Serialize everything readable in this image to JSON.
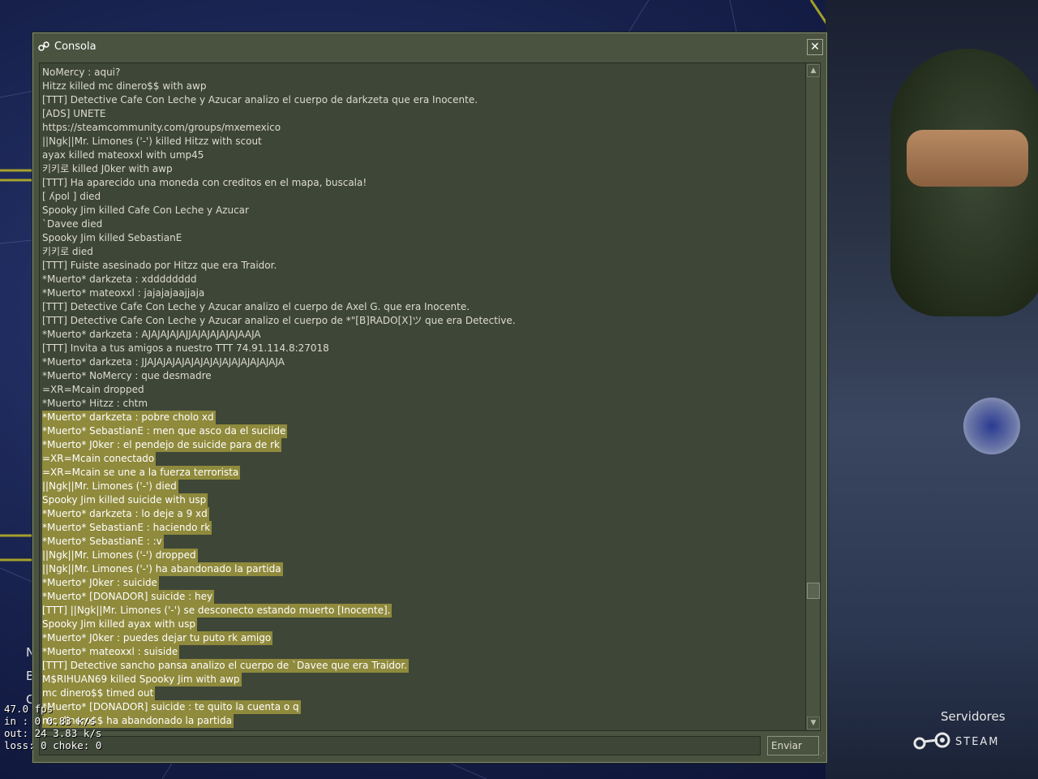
{
  "window": {
    "title": "Consola",
    "send_label": "Enviar",
    "input_value": ""
  },
  "log": [
    {
      "text": " NoMercy : aqui?",
      "hl": false
    },
    {
      "text": "Hitzz killed mc dinero$$ with awp",
      "hl": false
    },
    {
      "text": "[TTT] Detective Cafe Con Leche y Azucar analizo el cuerpo de darkzeta que era Inocente.",
      "hl": false
    },
    {
      "text": "[ADS] UNETE",
      "hl": false
    },
    {
      "text": "https://steamcommunity.com/groups/mxemexico",
      "hl": false
    },
    {
      "text": "||Ngk||Mr. Limones ('-') killed Hitzz with scout",
      "hl": false
    },
    {
      "text": "ayax killed mateoxxl with ump45",
      "hl": false
    },
    {
      "text": "키키로 killed J0ker with awp",
      "hl": false
    },
    {
      "text": "[TTT] Ha aparecido una moneda con creditos en el mapa, buscala!",
      "hl": false
    },
    {
      "text": "[ ʎpol ] died",
      "hl": false
    },
    {
      "text": "Spooky Jim killed Cafe Con Leche y Azucar",
      "hl": false
    },
    {
      "text": "`Davee died",
      "hl": false
    },
    {
      "text": "Spooky Jim killed SebastianE",
      "hl": false
    },
    {
      "text": "키키로 died",
      "hl": false
    },
    {
      "text": "[TTT] Fuiste asesinado por Hitzz que era Traidor.",
      "hl": false
    },
    {
      "text": "*Muerto*  darkzeta : xdddddddd",
      "hl": false
    },
    {
      "text": "*Muerto*  mateoxxl : jajajajaajjaja",
      "hl": false
    },
    {
      "text": "[TTT] Detective Cafe Con Leche y Azucar analizo el cuerpo de Axel G. que era Inocente.",
      "hl": false
    },
    {
      "text": "[TTT] Detective Cafe Con Leche y Azucar analizo el cuerpo de *\"[B]RADO[X]ツ que era Detective.",
      "hl": false
    },
    {
      "text": "*Muerto*  darkzeta : AJAJAJAJAJJAJAJAJAJAJAAJA",
      "hl": false
    },
    {
      "text": "[TTT] Invita a tus amigos a nuestro TTT 74.91.114.8:27018",
      "hl": false
    },
    {
      "text": "*Muerto*  darkzeta : JJAJAJAJAJAJAJAJAJAJAJAJAJAJAJA",
      "hl": false
    },
    {
      "text": "*Muerto*  NoMercy : que desmadre",
      "hl": false
    },
    {
      "text": "=XR=Mcain dropped",
      "hl": false
    },
    {
      "text": "*Muerto*  Hitzz : chtm",
      "hl": false
    },
    {
      "text": "*Muerto*  darkzeta : pobre cholo xd",
      "hl": true
    },
    {
      "text": "*Muerto*  SebastianE : men que asco da el suciide",
      "hl": true
    },
    {
      "text": "*Muerto*  J0ker : el pendejo de suicide para de rk",
      "hl": true
    },
    {
      "text": "=XR=Mcain conectado",
      "hl": true
    },
    {
      "text": "=XR=Mcain se une a la fuerza terrorista",
      "hl": true
    },
    {
      "text": "||Ngk||Mr. Limones ('-') died",
      "hl": true
    },
    {
      "text": "Spooky Jim killed suicide with usp",
      "hl": true
    },
    {
      "text": "*Muerto*  darkzeta : lo deje a 9 xd",
      "hl": true
    },
    {
      "text": "*Muerto*  SebastianE : haciendo rk",
      "hl": true
    },
    {
      "text": "*Muerto*  SebastianE : :v",
      "hl": true
    },
    {
      "text": "||Ngk||Mr. Limones ('-') dropped",
      "hl": true
    },
    {
      "text": "||Ngk||Mr. Limones ('-') ha abandonado la partida",
      "hl": true
    },
    {
      "text": "*Muerto*  J0ker : suicide",
      "hl": true
    },
    {
      "text": "*Muerto* [DONADOR] suicide : hey",
      "hl": true
    },
    {
      "text": "[TTT] ||Ngk||Mr. Limones ('-') se desconecto estando muerto [Inocente].",
      "hl": true
    },
    {
      "text": "Spooky Jim killed ayax with usp",
      "hl": true
    },
    {
      "text": "*Muerto*  J0ker : puedes dejar tu puto rk amigo",
      "hl": true
    },
    {
      "text": "*Muerto*  mateoxxl : suiside",
      "hl": true
    },
    {
      "text": "[TTT] Detective sancho pansa analizo el cuerpo de `Davee que era Traidor.",
      "hl": true
    },
    {
      "text": "M$RIHUAN69 killed Spooky Jim with awp",
      "hl": true
    },
    {
      "text": "mc dinero$$ timed out",
      "hl": true
    },
    {
      "text": "*Muerto* [DONADOR] suicide : te quito la cuenta o q",
      "hl": true
    },
    {
      "text": "mc dinero$$ ha abandonado la partida",
      "hl": true
    }
  ],
  "netgraph": {
    "fps": "47.0 fps",
    "in": "in :  0 0.83 k/s",
    "out": "out:  24 3.83 k/s",
    "loss": "loss: 0 choke:  0"
  },
  "background": {
    "servers_label": "Servidores",
    "steam_label": "STEAM",
    "menu_letters": [
      "N",
      "B",
      "C"
    ]
  },
  "colors": {
    "window_bg": "#4a5340",
    "log_bg": "#3e4637",
    "highlight": "#8f8a3c",
    "text": "#dcdcd0"
  }
}
